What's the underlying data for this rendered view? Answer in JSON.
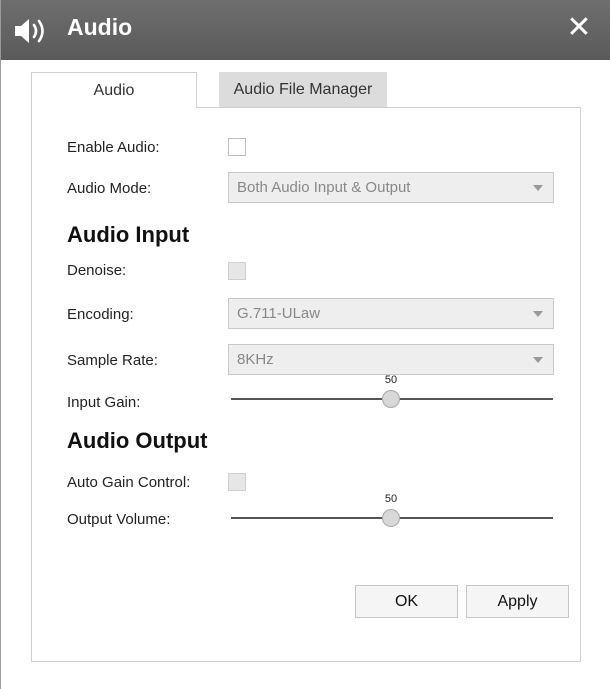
{
  "titlebar": {
    "title": "Audio",
    "icon": "speaker-icon",
    "close_glyph": "✕"
  },
  "tabs": [
    {
      "label": "Audio",
      "active": true
    },
    {
      "label": "Audio File Manager",
      "active": false
    }
  ],
  "form": {
    "enable_audio_label": "Enable Audio:",
    "enable_audio_checked": false,
    "audio_mode_label": "Audio Mode:",
    "audio_mode_value": "Both Audio Input & Output"
  },
  "audio_input": {
    "heading": "Audio Input",
    "denoise_label": "Denoise:",
    "denoise_checked": false,
    "encoding_label": "Encoding:",
    "encoding_value": "G.711-ULaw",
    "sample_rate_label": "Sample Rate:",
    "sample_rate_value": "8KHz",
    "input_gain_label": "Input Gain:",
    "input_gain_value": "50"
  },
  "audio_output": {
    "heading": "Audio Output",
    "agc_label": "Auto Gain Control:",
    "agc_checked": false,
    "output_volume_label": "Output Volume:",
    "output_volume_value": "50"
  },
  "buttons": {
    "ok_label": "OK",
    "apply_label": "Apply"
  },
  "colors": {
    "titlebar": "#5f5f5f",
    "tab_inactive": "#dcdcdc",
    "disabled_field": "#eeeeee"
  }
}
